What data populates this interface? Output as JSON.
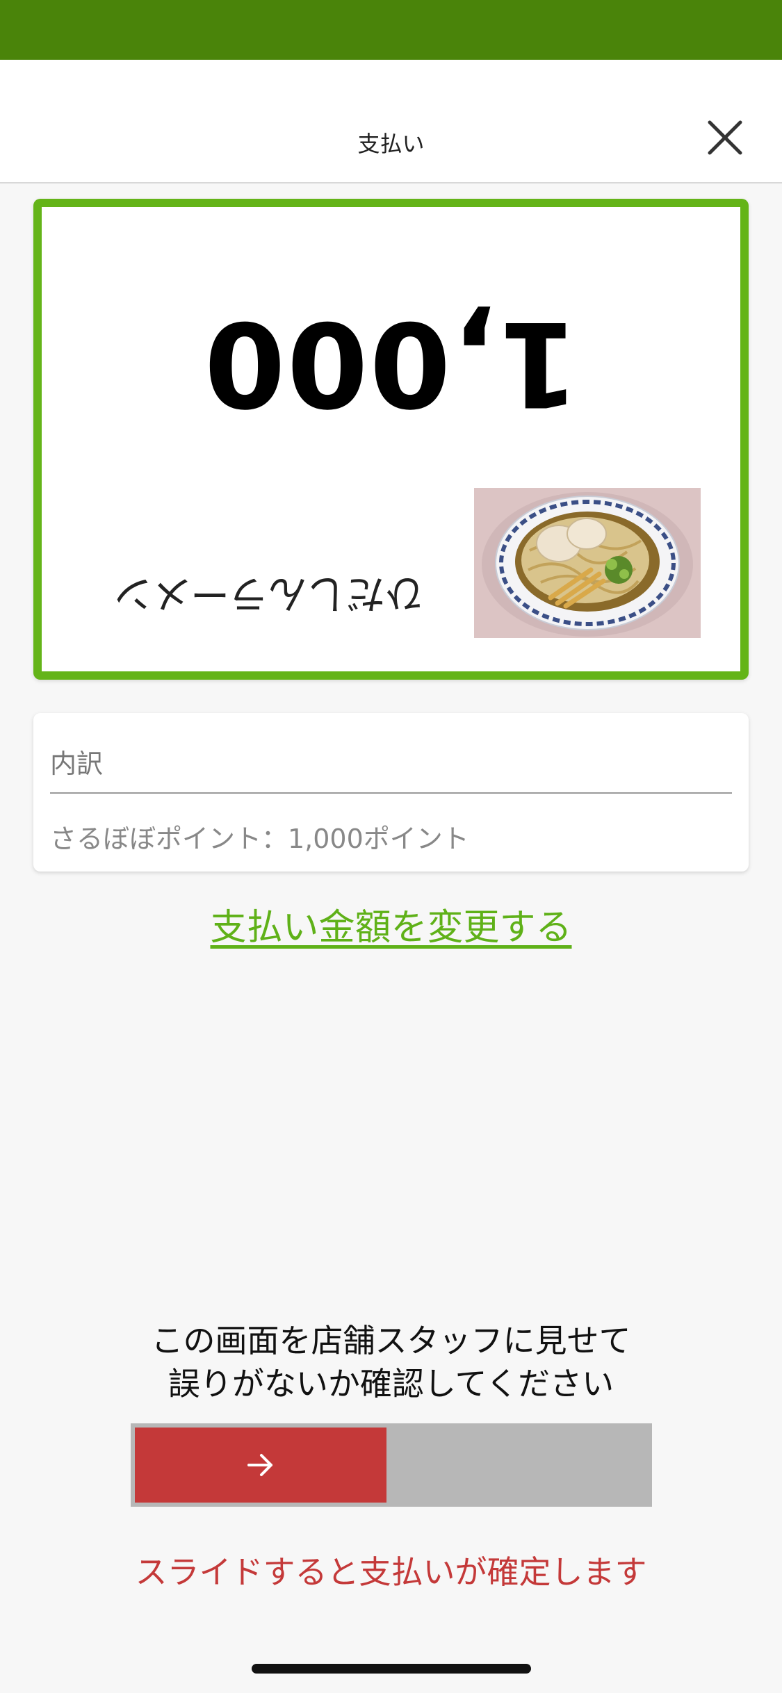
{
  "header": {
    "title": "支払い",
    "close_icon": "close-icon"
  },
  "payment": {
    "amount": "1,000",
    "product_name": "ひだしんラーメン",
    "product_image": "ramen-bowl",
    "display_orientation": "upside-down",
    "border_color": "#64b418"
  },
  "breakdown": {
    "title": "内訳",
    "detail": "さるぼぼポイント：1,000ポイント"
  },
  "change_amount_link": "支払い金額を変更する",
  "instruction": {
    "line1": "この画面を店舗スタッフに見せて",
    "line2": "誤りがないか確認してください"
  },
  "slider": {
    "handle_icon": "arrow-right-icon",
    "hint": "スライドすると支払いが確定します",
    "accent_color": "#c43939"
  },
  "colors": {
    "brand": "#4a840a",
    "link": "#5fb118"
  }
}
